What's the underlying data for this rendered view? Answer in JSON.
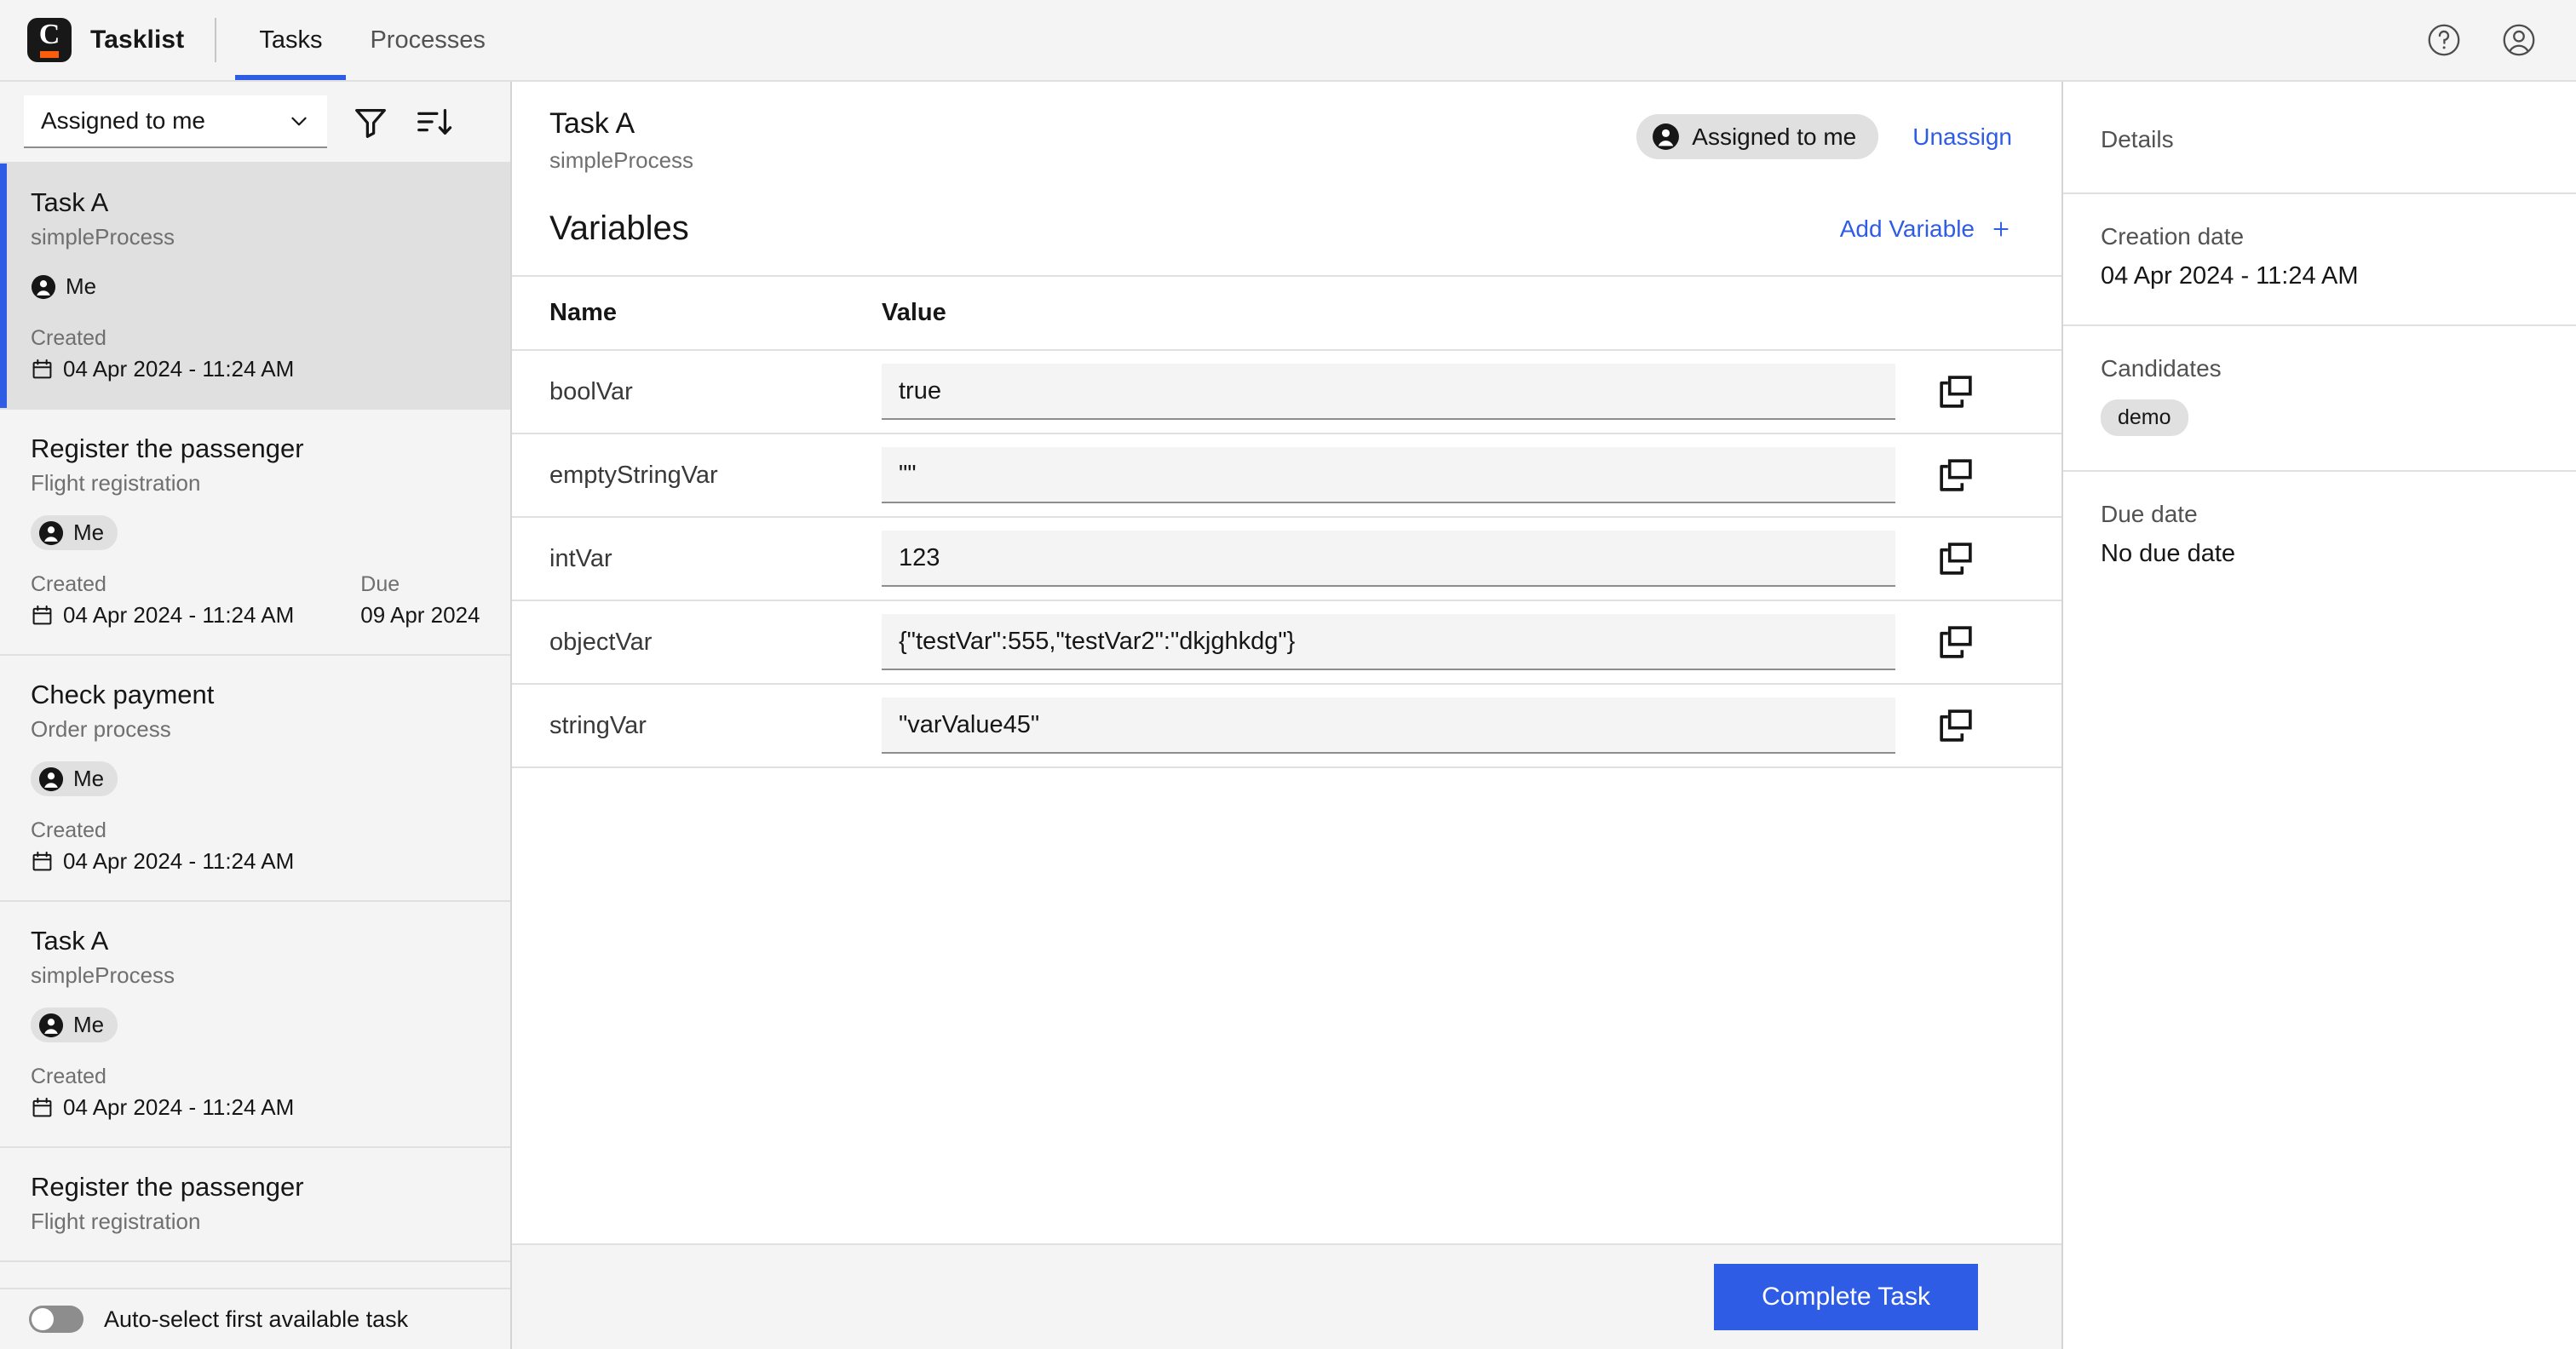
{
  "header": {
    "brand": "Tasklist",
    "logo_letter": "C",
    "tabs": [
      {
        "label": "Tasks",
        "active": true
      },
      {
        "label": "Processes",
        "active": false
      }
    ],
    "help_icon": "help-circle-icon",
    "user_icon": "user-avatar-icon"
  },
  "filter_bar": {
    "dropdown_value": "Assigned to me",
    "filter_icon": "filter-funnel-icon",
    "sort_icon": "sort-descending-icon"
  },
  "task_list": {
    "items": [
      {
        "name": "Task A",
        "process": "simpleProcess",
        "assignee": "Me",
        "created_label": "Created",
        "created_value": "04 Apr 2024 - 11:24 AM",
        "due_label": "",
        "due_value": "",
        "selected": true
      },
      {
        "name": "Register the passenger",
        "process": "Flight registration",
        "assignee": "Me",
        "created_label": "Created",
        "created_value": "04 Apr 2024 - 11:24 AM",
        "due_label": "Due",
        "due_value": "09 Apr 2024",
        "selected": false
      },
      {
        "name": "Check payment",
        "process": "Order process",
        "assignee": "Me",
        "created_label": "Created",
        "created_value": "04 Apr 2024 - 11:24 AM",
        "due_label": "",
        "due_value": "",
        "selected": false
      },
      {
        "name": "Task A",
        "process": "simpleProcess",
        "assignee": "Me",
        "created_label": "Created",
        "created_value": "04 Apr 2024 - 11:24 AM",
        "due_label": "",
        "due_value": "",
        "selected": false
      },
      {
        "name": "Register the passenger",
        "process": "Flight registration",
        "assignee": "",
        "created_label": "",
        "created_value": "",
        "due_label": "",
        "due_value": "",
        "selected": false
      }
    ],
    "autoselect_label": "Auto-select first available task",
    "autoselect_on": false
  },
  "detail": {
    "title": "Task A",
    "subtitle": "simpleProcess",
    "assigned_pill": "Assigned to me",
    "unassign_label": "Unassign",
    "variables_title": "Variables",
    "add_variable_label": "Add Variable",
    "columns": {
      "name": "Name",
      "value": "Value"
    },
    "variables": [
      {
        "name": "boolVar",
        "value": "true"
      },
      {
        "name": "emptyStringVar",
        "value": "\"\""
      },
      {
        "name": "intVar",
        "value": "123"
      },
      {
        "name": "objectVar",
        "value": "{\"testVar\":555,\"testVar2\":\"dkjghkdg\"}"
      },
      {
        "name": "stringVar",
        "value": "\"varValue45\""
      }
    ],
    "copy_icon": "copy-icon",
    "complete_label": "Complete Task"
  },
  "details_panel": {
    "title": "Details",
    "creation_date_label": "Creation date",
    "creation_date_value": "04 Apr 2024 - 11:24 AM",
    "candidates_label": "Candidates",
    "candidates": [
      "demo"
    ],
    "due_date_label": "Due date",
    "due_date_value": "No due date"
  },
  "colors": {
    "accent_blue": "#2f5ce5",
    "logo_orange": "#fc5d0d",
    "surface": "#f4f4f4",
    "selected": "#e0e0e0"
  }
}
